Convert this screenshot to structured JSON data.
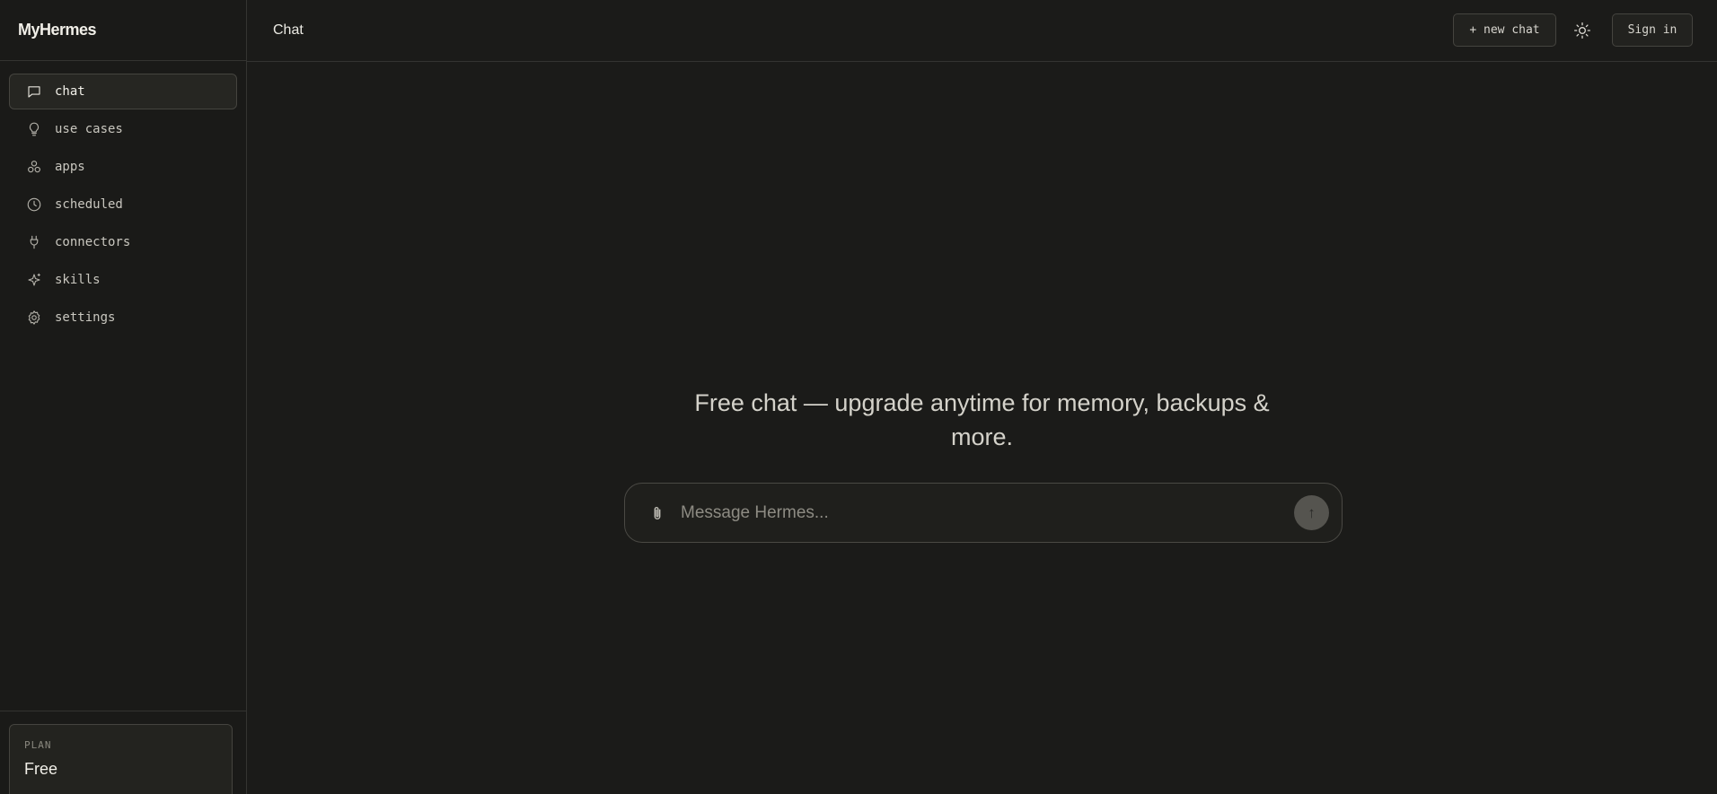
{
  "app": {
    "brand": "MyHermes"
  },
  "sidebar": {
    "items": [
      {
        "label": "chat",
        "icon": "message-square-icon",
        "active": true
      },
      {
        "label": "use cases",
        "icon": "lightbulb-icon",
        "active": false
      },
      {
        "label": "apps",
        "icon": "grid-circles-icon",
        "active": false
      },
      {
        "label": "scheduled",
        "icon": "clock-icon",
        "active": false
      },
      {
        "label": "connectors",
        "icon": "plug-icon",
        "active": false
      },
      {
        "label": "skills",
        "icon": "sparkle-icon",
        "active": false
      },
      {
        "label": "settings",
        "icon": "gear-icon",
        "active": false
      }
    ],
    "plan": {
      "label": "PLAN",
      "value": "Free"
    }
  },
  "header": {
    "title": "Chat",
    "new_chat_label": "+ new chat",
    "theme_icon": "sun-icon",
    "sign_in_label": "Sign in"
  },
  "main": {
    "hero_text": "Free chat — upgrade anytime for memory, backups & more.",
    "composer": {
      "placeholder": "Message Hermes...",
      "attach_icon": "paperclip-icon",
      "send_icon": "arrow-up-icon",
      "send_glyph": "↑"
    }
  },
  "colors": {
    "background": "#1b1b19",
    "border": "#343431",
    "active_item": "#262622",
    "text": "#d8d6cf"
  }
}
